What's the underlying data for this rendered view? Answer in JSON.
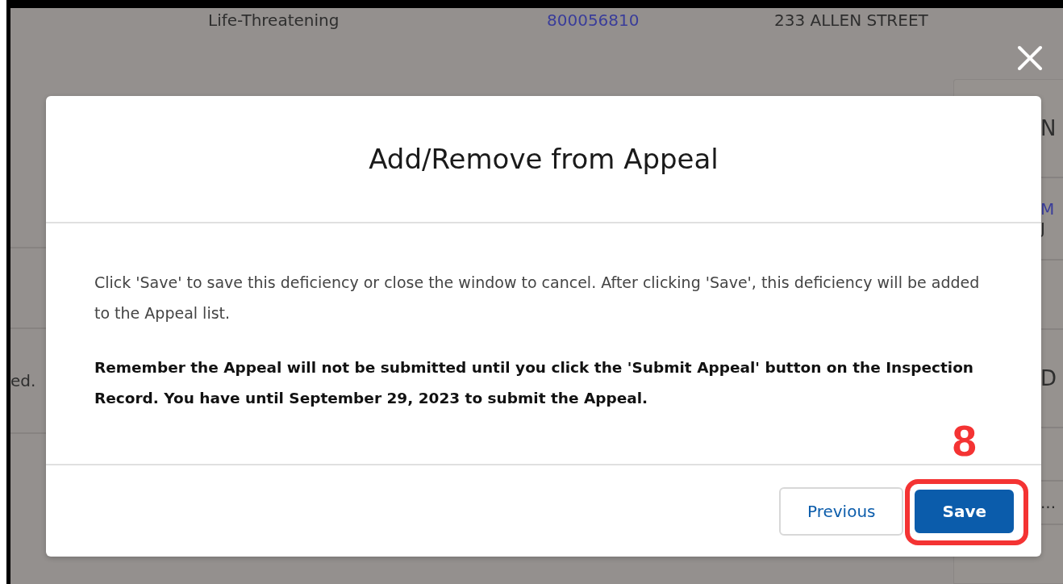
{
  "background_page": {
    "record_row": {
      "severity": "Life-Threatening",
      "record_number": "800056810",
      "address": "233 ALLEN STREET"
    },
    "left_column": {
      "text": "ed."
    },
    "right_panel": {
      "heading": "N",
      "link": "M",
      "date": "J",
      "section_heading": "D",
      "value": "..."
    }
  },
  "modal": {
    "title": "Add/Remove from Appeal",
    "message": "Click 'Save' to save this deficiency or close the window to cancel. After clicking 'Save', this deficiency will be added to the Appeal list.",
    "notice": "Remember the Appeal will not be submitted until you click the 'Submit Appeal' button on the Inspection Record. You have until September 29, 2023 to submit the Appeal.",
    "buttons": [
      {
        "label": "Previous",
        "kind": "neutral",
        "highlighted": false
      },
      {
        "label": "Save",
        "kind": "brand",
        "highlighted": true
      }
    ]
  },
  "annotation": {
    "step": "8"
  }
}
